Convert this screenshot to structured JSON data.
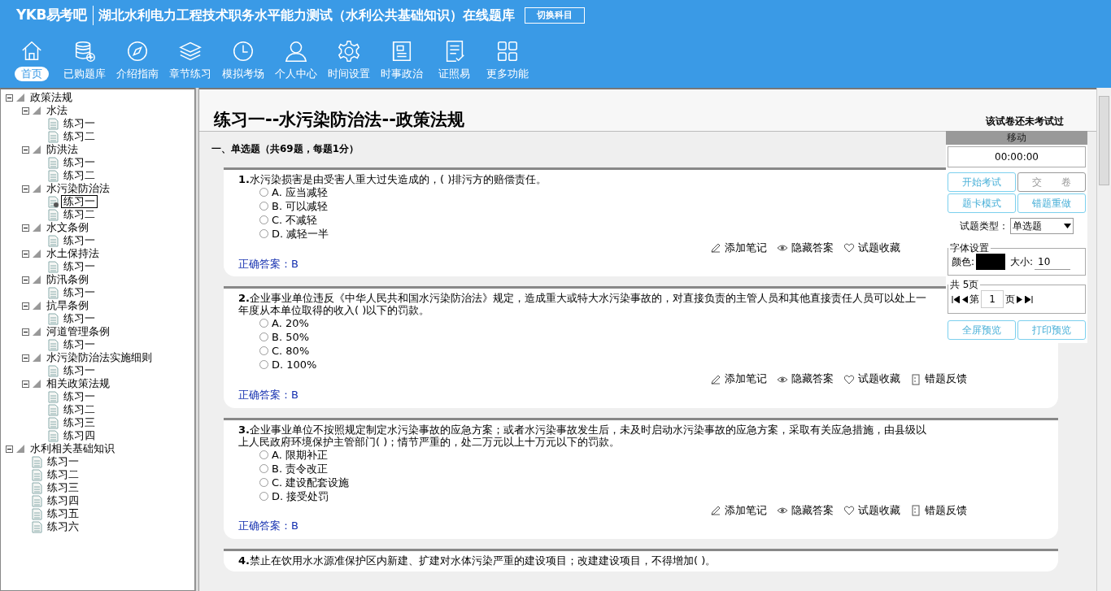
{
  "header": {
    "logo": "YKB易考吧",
    "title": "湖北水利电力工程技术职务水平能力测试（水利公共基础知识）在线题库",
    "switch_button": "切换科目"
  },
  "nav": [
    {
      "label": "首页",
      "selected": true
    },
    {
      "label": "已购题库",
      "selected": false
    },
    {
      "label": "介绍指南",
      "selected": false
    },
    {
      "label": "章节练习",
      "selected": false
    },
    {
      "label": "模拟考场",
      "selected": false
    },
    {
      "label": "个人中心",
      "selected": false
    },
    {
      "label": "时间设置",
      "selected": false
    },
    {
      "label": "时事政治",
      "selected": false
    },
    {
      "label": "证照易",
      "selected": false
    },
    {
      "label": "更多功能",
      "selected": false
    }
  ],
  "tree": [
    {
      "label": "政策法规",
      "expanded": true,
      "children": [
        {
          "label": "水法",
          "expanded": true,
          "children": [
            {
              "label": "练习一",
              "selected": false
            },
            {
              "label": "练习二",
              "selected": false
            }
          ]
        },
        {
          "label": "防洪法",
          "expanded": true,
          "children": [
            {
              "label": "练习一",
              "selected": false
            },
            {
              "label": "练习二",
              "selected": false
            }
          ]
        },
        {
          "label": "水污染防治法",
          "expanded": true,
          "children": [
            {
              "label": "练习一",
              "selected": true
            },
            {
              "label": "练习二",
              "selected": false
            }
          ]
        },
        {
          "label": "水文条例",
          "expanded": true,
          "children": [
            {
              "label": "练习一",
              "selected": false
            }
          ]
        },
        {
          "label": "水土保持法",
          "expanded": true,
          "children": [
            {
              "label": "练习一",
              "selected": false
            }
          ]
        },
        {
          "label": "防汛条例",
          "expanded": true,
          "children": [
            {
              "label": "练习一",
              "selected": false
            }
          ]
        },
        {
          "label": "抗旱条例",
          "expanded": true,
          "children": [
            {
              "label": "练习一",
              "selected": false
            }
          ]
        },
        {
          "label": "河道管理条例",
          "expanded": true,
          "children": [
            {
              "label": "练习一",
              "selected": false
            }
          ]
        },
        {
          "label": "水污染防治法实施细则",
          "expanded": true,
          "children": [
            {
              "label": "练习一",
              "selected": false
            }
          ]
        },
        {
          "label": "相关政策法规",
          "expanded": true,
          "children": [
            {
              "label": "练习一",
              "selected": false
            },
            {
              "label": "练习二",
              "selected": false
            },
            {
              "label": "练习三",
              "selected": false
            },
            {
              "label": "练习四",
              "selected": false
            }
          ]
        }
      ]
    },
    {
      "label": "水利相关基础知识",
      "expanded": true,
      "children": [
        {
          "label": "练习一",
          "selected": false
        },
        {
          "label": "练习二",
          "selected": false
        },
        {
          "label": "练习三",
          "selected": false
        },
        {
          "label": "练习四",
          "selected": false
        },
        {
          "label": "练习五",
          "selected": false
        },
        {
          "label": "练习六",
          "selected": false
        }
      ]
    }
  ],
  "paper": {
    "title": "练习一--水污染防治法--政策法规",
    "status": "该试卷还未考试过",
    "section": "一、单选题（共69题，每题1分）",
    "questions": [
      {
        "number": "1.",
        "text": "水污染损害是由受害人重大过失造成的，( )排污方的赔偿责任。",
        "options": [
          {
            "label": "A. 应当减轻",
            "checked": false
          },
          {
            "label": "B. 可以减轻",
            "checked": false
          },
          {
            "label": "C. 不减轻",
            "checked": false
          },
          {
            "label": "D. 减轻一半",
            "checked": false
          }
        ],
        "actions": [
          "添加笔记",
          "隐藏答案",
          "试题收藏"
        ],
        "answer": "正确答案：B"
      },
      {
        "number": "2.",
        "text": "企业事业单位违反《中华人民共和国水污染防治法》规定，造成重大或特大水污染事故的，对直接负责的主管人员和其他直接责任人员可以处上一年度从本单位取得的收入( )以下的罚款。",
        "options": [
          {
            "label": "A. 20%",
            "checked": false
          },
          {
            "label": "B. 50%",
            "checked": false
          },
          {
            "label": "C. 80%",
            "checked": false
          },
          {
            "label": "D. 100%",
            "checked": false
          }
        ],
        "actions": [
          "添加笔记",
          "隐藏答案",
          "试题收藏",
          "错题反馈"
        ],
        "answer": "正确答案：B"
      },
      {
        "number": "3.",
        "text": "企业事业单位不按照规定制定水污染事故的应急方案；或者水污染事故发生后，未及时启动水污染事故的应急方案，采取有关应急措施，由县级以上人民政府环境保护主管部门( )；情节严重的，处二万元以上十万元以下的罚款。",
        "options": [
          {
            "label": "A. 限期补正",
            "checked": false
          },
          {
            "label": "B. 责令改正",
            "checked": false
          },
          {
            "label": "C. 建设配套设施",
            "checked": false
          },
          {
            "label": "D. 接受处罚",
            "checked": false
          }
        ],
        "actions": [
          "添加笔记",
          "隐藏答案",
          "试题收藏",
          "错题反馈"
        ],
        "answer": "正确答案：B"
      },
      {
        "number": "4.",
        "text": "禁止在饮用水水源准保护区内新建、扩建对水体污染严重的建设项目；改建建设项目，不得增加( )。"
      }
    ]
  },
  "panel": {
    "header": "移动",
    "timer": "00:00:00",
    "buttons": [
      {
        "label": "开始考试",
        "disabled": false
      },
      {
        "label": "交　　卷",
        "disabled": true
      },
      {
        "label": "题卡模式",
        "disabled": false
      },
      {
        "label": "错题重做",
        "disabled": false
      }
    ],
    "type_label": "试题类型：",
    "type_value": "单选题",
    "font_legend": "字体设置",
    "color_label": "颜色:",
    "color": "#000000",
    "size_label": "大小:",
    "size_value": "10",
    "pages_legend": "共 5页",
    "page_prefix": "第",
    "page_value": "1",
    "page_suffix": "页",
    "bottom_buttons": [
      "全屏预览",
      "打印预览"
    ]
  }
}
